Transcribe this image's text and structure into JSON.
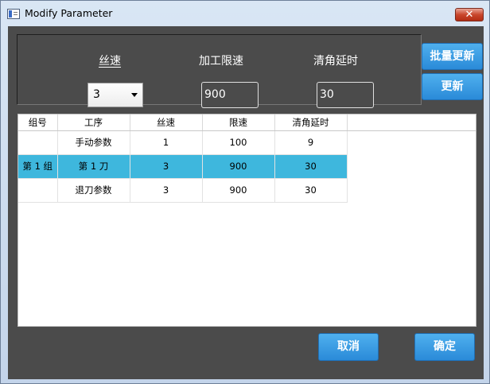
{
  "window": {
    "title": "Modify Parameter",
    "close_glyph": "✕"
  },
  "params": {
    "speed_label": "丝速",
    "speed_value": "3",
    "limit_label": "加工限速",
    "limit_value": "900",
    "delay_label": "清角延时",
    "delay_value": "30"
  },
  "buttons": {
    "batch_update": "批量更新",
    "update": "更新",
    "cancel": "取消",
    "ok": "确定"
  },
  "table": {
    "headers": [
      "组号",
      "工序",
      "丝速",
      "限速",
      "清角延时"
    ],
    "rows": [
      [
        "",
        "手动参数",
        "1",
        "100",
        "9"
      ],
      [
        "第 1 组",
        "第 1 刀",
        "3",
        "900",
        "30"
      ],
      [
        "",
        "退刀参数",
        "3",
        "900",
        "30"
      ]
    ],
    "selected_row": 1
  },
  "colors": {
    "accent": "#2a8ad8",
    "selected_row": "#3eb7dd",
    "panel": "#4b4b4b"
  }
}
